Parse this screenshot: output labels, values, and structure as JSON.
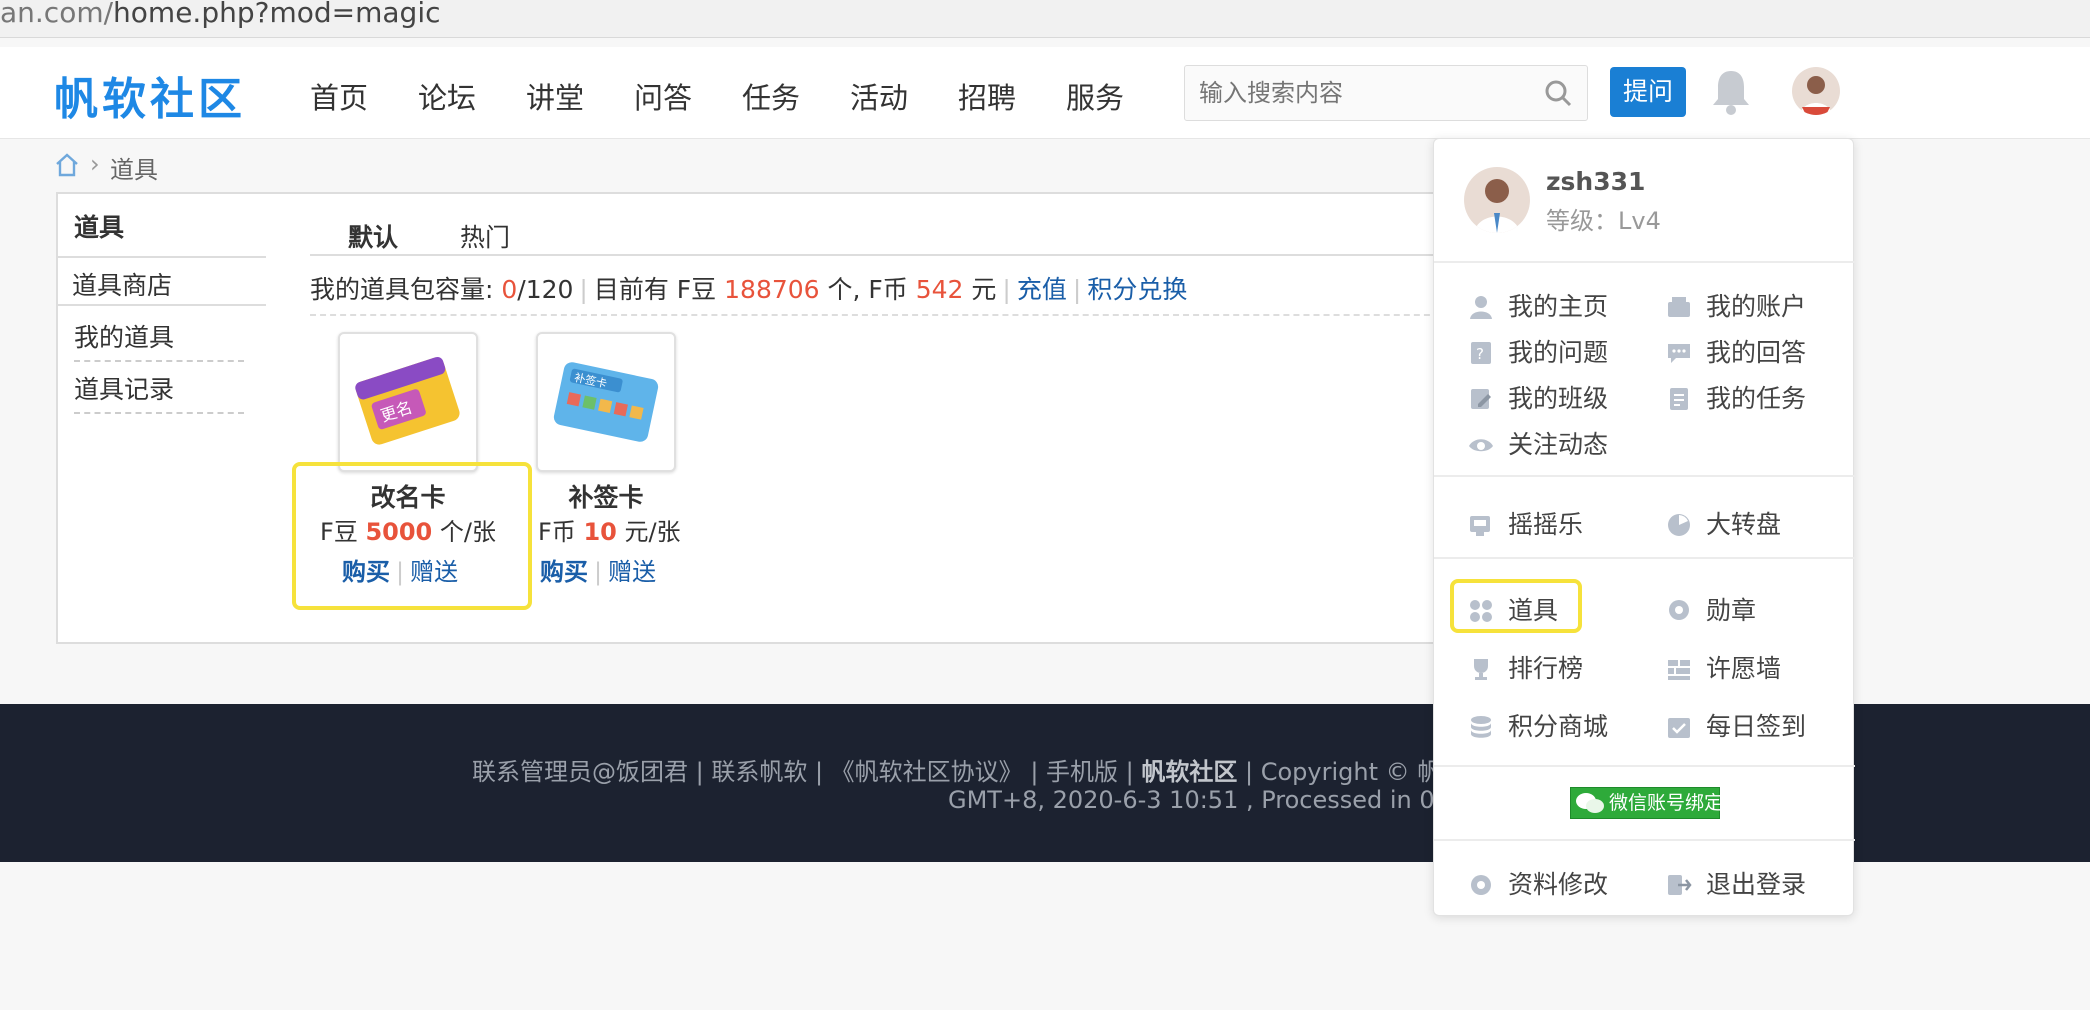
{
  "browser": {
    "url_dim": "an.com/",
    "url_rest": "home.php?mod=magic"
  },
  "header": {
    "logo": "帆软社区",
    "nav": [
      "首页",
      "论坛",
      "讲堂",
      "问答",
      "任务",
      "活动",
      "招聘",
      "服务"
    ],
    "search_placeholder": "输入搜索内容",
    "ask_label": "提问"
  },
  "breadcrumb": {
    "current": "道具"
  },
  "sidebar": {
    "title": "道具",
    "items": [
      "道具商店",
      "我的道具",
      "道具记录"
    ]
  },
  "tabs": [
    "默认",
    "热门"
  ],
  "info": {
    "capacity_label": "我的道具包容量: ",
    "capacity_used": "0",
    "capacity_total": "/120",
    "balance_prefix": "目前有 F豆 ",
    "fdou": "188706",
    "mid": " 个, F币 ",
    "fbi": "542",
    "yuan": " 元",
    "recharge": "充值",
    "exchange": "积分兑换"
  },
  "items": [
    {
      "name": "改名卡",
      "price_prefix": "F豆 ",
      "price": "5000",
      "price_suffix": " 个/张",
      "buy": "购买",
      "gift": "赠送"
    },
    {
      "name": "补签卡",
      "price_prefix": "F币 ",
      "price": "10",
      "price_suffix": " 元/张",
      "buy": "购买",
      "gift": "赠送"
    }
  ],
  "footer": {
    "line1_a": "联系管理员@饭团君 | 联系帆软 | 《帆软社区协议》 | 手机版 | ",
    "line1_brand": "帆软社区",
    "line1_b": " | Copyright © 帆软",
    "line2": "GMT+8, 2020-6-3 10:51 , Processed in 0.0"
  },
  "dropdown": {
    "username": "zsh331",
    "level": "等级：Lv4",
    "group1": [
      "我的主页",
      "我的账户",
      "我的问题",
      "我的回答",
      "我的班级",
      "我的任务",
      "关注动态"
    ],
    "group2": [
      "摇摇乐",
      "大转盘"
    ],
    "group3": [
      "道具",
      "勋章",
      "排行榜",
      "许愿墙",
      "积分商城",
      "每日签到"
    ],
    "wechat": "微信账号绑定",
    "group4": [
      "资料修改",
      "退出登录"
    ]
  },
  "colors": {
    "brand": "#1e88e5",
    "button": "#1a7fd4",
    "accent_red": "#e8533b",
    "highlight": "#f6e23b",
    "footer_bg": "#1c2230"
  }
}
